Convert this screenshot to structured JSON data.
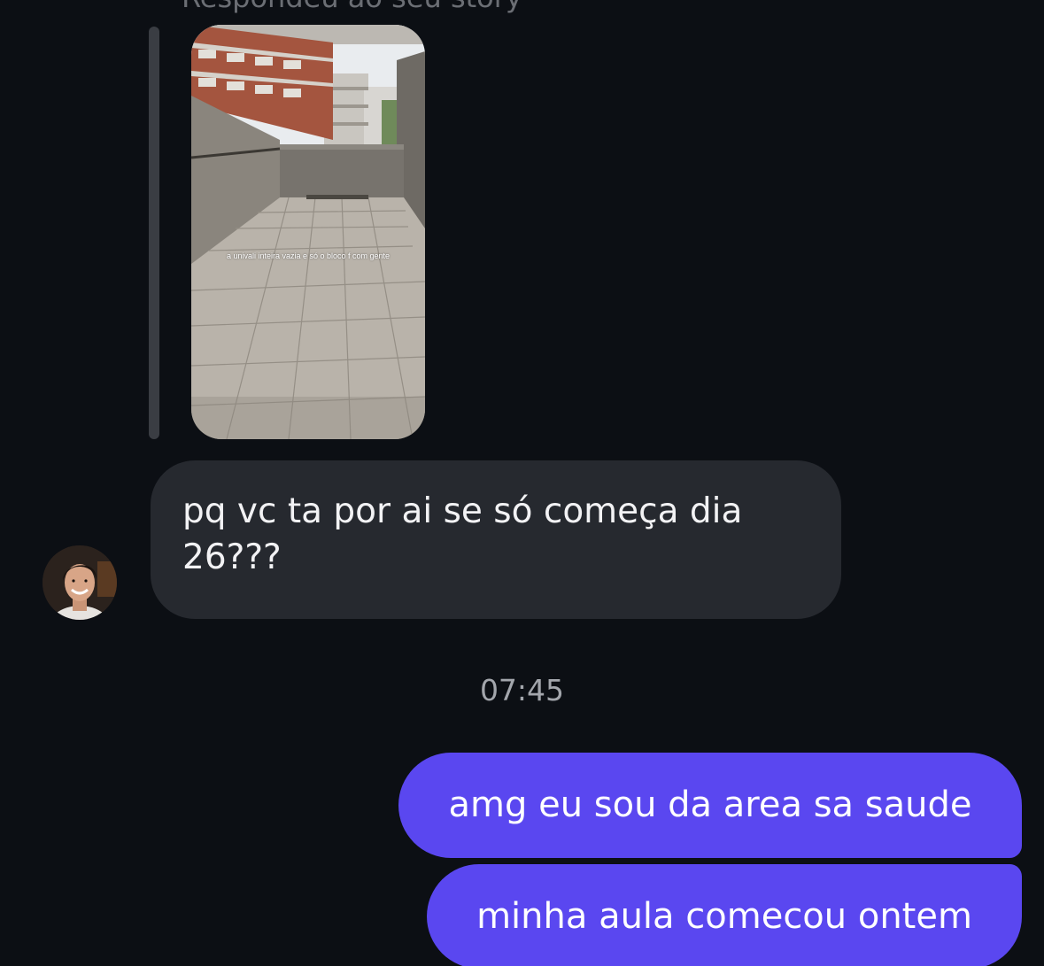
{
  "thread": {
    "reply_label": "Respondeu ao seu story",
    "story": {
      "caption": "a univali inteira vazia e só o bloco f com gente"
    },
    "incoming_message": {
      "text": "pq vc ta por ai se só começa dia 26???"
    },
    "timestamp": "07:45",
    "outgoing_messages": [
      {
        "text": "amg eu sou da area sa saude"
      },
      {
        "text": "minha aula comecou ontem"
      }
    ]
  },
  "colors": {
    "background": "#0c0f14",
    "incoming_bubble": "#26292f",
    "outgoing_bubble": "#5a47f0",
    "timestamp_text": "#a3a6ac",
    "quote_bar": "#3a3d43"
  },
  "icons": [
    "avatar"
  ]
}
